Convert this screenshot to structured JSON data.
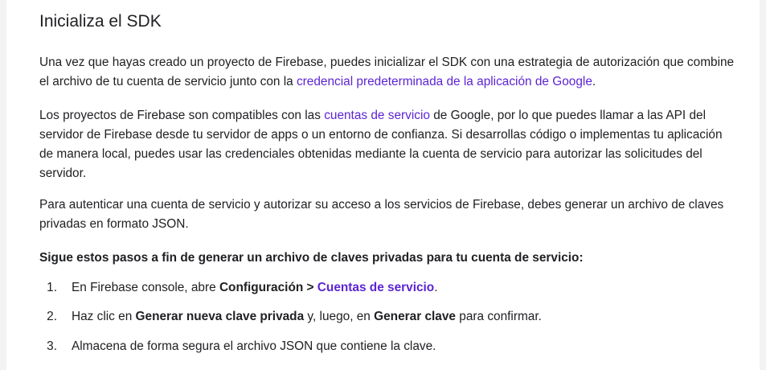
{
  "section": {
    "title": "Inicializa el SDK"
  },
  "para1": {
    "text": "Una vez que hayas creado un proyecto de Firebase, puedes inicializar el SDK con una estrategia de autorización que combine el archivo de tu cuenta de servicio junto con la ",
    "link": "credencial predeterminada de la aplicación de Google",
    "end": "."
  },
  "para2": {
    "before": "Los proyectos de Firebase son compatibles con las ",
    "link": "cuentas de servicio",
    "after": " de Google, por lo que puedes llamar a las API del servidor de Firebase desde tu servidor de apps o un entorno de confianza. Si desarrollas código o implementas tu aplicación de manera local, puedes usar las credenciales obtenidas mediante la cuenta de servicio para autorizar las solicitudes del servidor."
  },
  "para3": {
    "text": "Para autenticar una cuenta de servicio y autorizar su acceso a los servicios de Firebase, debes generar un archivo de claves privadas en formato JSON."
  },
  "para4": {
    "text": "Sigue estos pasos a fin de generar un archivo de claves privadas para tu cuenta de servicio:"
  },
  "steps": [
    {
      "num": "1.",
      "before": "En Firebase console, abre ",
      "bold1": "Configuración > ",
      "link": "Cuentas de servicio",
      "after": "."
    },
    {
      "num": "2.",
      "before": "Haz clic en ",
      "bold1": "Generar nueva clave privada",
      "middle": " y, luego, en ",
      "bold2": "Generar clave",
      "after": " para confirmar."
    },
    {
      "num": "3.",
      "text": "Almacena de forma segura el archivo JSON que contiene la clave."
    }
  ]
}
